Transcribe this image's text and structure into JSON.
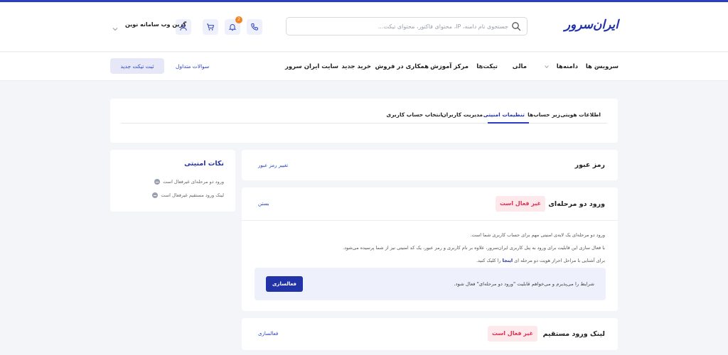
{
  "header": {
    "logo": "ایران‌سرور",
    "search_placeholder": "جستجوی نام دامنه، IP، محتوای فاکتور، محتوای تیکت...",
    "notification_count": "2",
    "username": "گرین وب سامانه نوین"
  },
  "nav": {
    "items": [
      "سرویس ها",
      "دامنه‌ها",
      "مالی",
      "تیکت‌ها",
      "مرکز آموزش",
      "همکاری در فروش",
      "خرید جدید",
      "سایت ایران سرور"
    ],
    "faq": "سوالات متداول",
    "new_ticket": "ثبت تیکت جدید"
  },
  "tabs": [
    "اطلاعات هویتی",
    "زیر حساب‌ها",
    "تنظیمات امنیتی",
    "مدیریت کاربران",
    "انتخاب حساب کاربری"
  ],
  "active_tab": "تنظیمات امنیتی",
  "tips": {
    "title": "نکات امنیتی",
    "items": [
      "ورود دو مرحله‌ای غیرفعال است",
      "لینک ورود مستقیم غیرفعال است"
    ]
  },
  "password": {
    "title": "رمز عبور",
    "link": "تغییر رمز عبور"
  },
  "twofa": {
    "title": "ورود دو مرحله‌ای",
    "status": "غیر فعال است",
    "close": "بستن",
    "p1": "ورود دو مرحله‌ای یک لایه‌ی امنیتی مهم برای حساب کاربری شما است.",
    "p2": "با فعال سازی این قابلیت برای ورود به پنل کاربری ایران‌سرور، علاوه بر نام کاربری و رمز عبور، یک کد امنیتی نیز از شما پرسیده می‌شود.",
    "p3_before": "برای آشنایی با مراحل احراز هویت دو مرحله ای",
    "p3_link": "اینجا",
    "p3_after": "را کلیک کنید.",
    "terms": "شرایط را می‌پذیرم و می‌خواهم قابلیت \"ورود دو مرحله‌ای\" فعال شود.",
    "activate": "فعالسازی"
  },
  "direct_link": {
    "title": "لینک ورود مستقیم",
    "status": "غیر فعال است",
    "activate": "فعالسازی"
  },
  "colors": {
    "brand": "#2233a8",
    "accent": "#2b3fc4",
    "danger": "#e0304e",
    "badge": "#f5821f"
  }
}
